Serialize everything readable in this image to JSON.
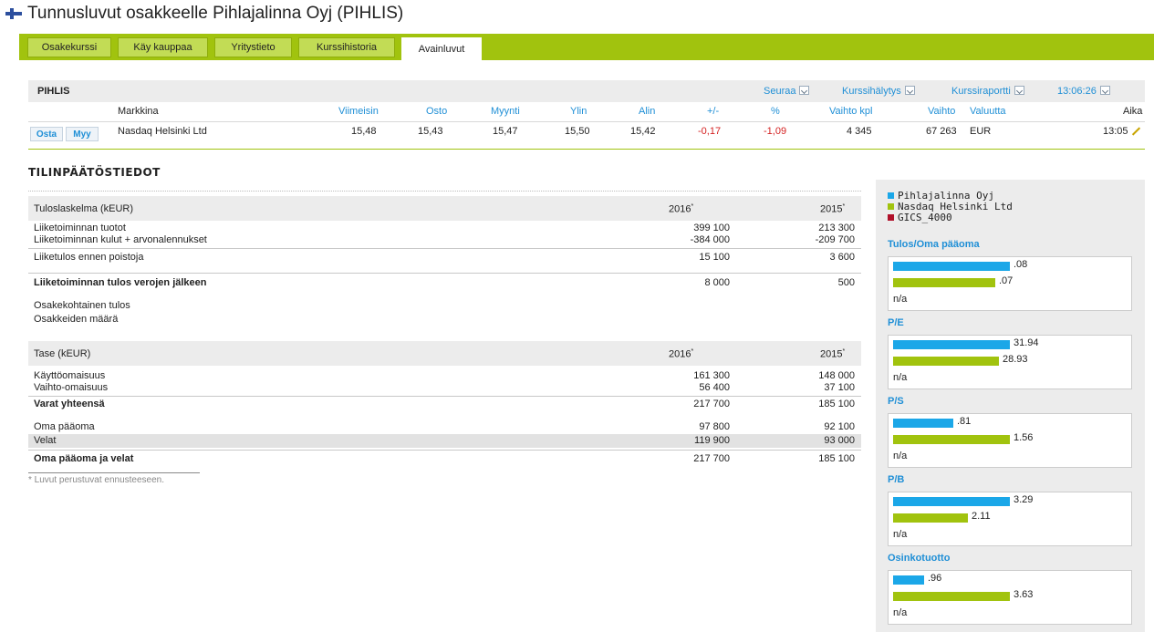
{
  "title": "Tunnusluvut osakkeelle Pihlajalinna Oyj (PIHLIS)",
  "tabs": [
    "Osakekurssi",
    "Käy kauppaa",
    "Yritystieto",
    "Kurssihistoria",
    "Avainluvut"
  ],
  "active_tab": "Avainluvut",
  "quote": {
    "symbol": "PIHLIS",
    "links": {
      "follow": "Seuraa",
      "alert": "Kurssihälytys",
      "report": "Kurssiraportti",
      "time": "13:06:26"
    },
    "columns": [
      "Markkina",
      "Viimeisin",
      "Osto",
      "Myynti",
      "Ylin",
      "Alin",
      "+/-",
      "%",
      "Vaihto kpl",
      "Vaihto",
      "Valuutta",
      "Aika"
    ],
    "row": {
      "buy": "Osta",
      "sell": "Myy",
      "market": "Nasdaq Helsinki Ltd",
      "last": "15,48",
      "bid": "15,43",
      "ask": "15,47",
      "high": "15,50",
      "low": "15,42",
      "change": "-0,17",
      "pct": "-1,09",
      "volume": "4 345",
      "turnover": "67 263",
      "currency": "EUR",
      "time": "13:05"
    },
    "negative_color": "#d42222"
  },
  "financials": {
    "section_title": "TILINPÄÄTÖSTIEDOT",
    "income": {
      "header": "Tuloslaskelma (kEUR)",
      "year1": "2016",
      "year2": "2015",
      "rows": [
        {
          "label": "Liiketoiminnan tuotot",
          "v1": "399 100",
          "v2": "213 300"
        },
        {
          "label": "Liiketoiminnan kulut + arvonalennukset",
          "v1": "-384 000",
          "v2": "-209 700"
        },
        {
          "label": "Liiketulos ennen poistoja",
          "v1": "15 100",
          "v2": "3 600"
        },
        {
          "label": "Liiketoiminnan tulos verojen jälkeen",
          "v1": "8 000",
          "v2": "500"
        },
        {
          "label": "Osakekohtainen tulos",
          "v1": "",
          "v2": ""
        },
        {
          "label": "Osakkeiden määrä",
          "v1": "",
          "v2": ""
        }
      ]
    },
    "balance": {
      "header": "Tase (kEUR)",
      "year1": "2016",
      "year2": "2015",
      "rows": [
        {
          "label": "Käyttöomaisuus",
          "v1": "161 300",
          "v2": "148 000"
        },
        {
          "label": "Vaihto-omaisuus",
          "v1": "56 400",
          "v2": "37 100"
        },
        {
          "label": "Varat yhteensä",
          "v1": "217 700",
          "v2": "185 100"
        },
        {
          "label": "Oma pääoma",
          "v1": "97 800",
          "v2": "92 100"
        },
        {
          "label": "Velat",
          "v1": "119 900",
          "v2": "93 000"
        },
        {
          "label": "Oma pääoma ja velat",
          "v1": "217 700",
          "v2": "185 100"
        }
      ]
    },
    "footnote": "* Luvut perustuvat ennusteeseen."
  },
  "side_panel": {
    "legend": [
      {
        "name": "Pihlajalinna Oyj",
        "color": "#1ba7e8"
      },
      {
        "name": "Nasdaq Helsinki Ltd",
        "color": "#a1c30e"
      },
      {
        "name": "GICS_4000",
        "color": "#b0102a"
      }
    ],
    "metrics": [
      {
        "title": "Tulos/Oma pääoma",
        "company": ".08",
        "market": ".07",
        "sector": "n/a"
      },
      {
        "title": "P/E",
        "company": "31.94",
        "market": "28.93",
        "sector": "n/a"
      },
      {
        "title": "P/S",
        "company": ".81",
        "market": "1.56",
        "sector": "n/a"
      },
      {
        "title": "P/B",
        "company": "3.29",
        "market": "2.11",
        "sector": "n/a"
      },
      {
        "title": "Osinkotuotto",
        "company": ".96",
        "market": "3.63",
        "sector": "n/a"
      }
    ]
  }
}
